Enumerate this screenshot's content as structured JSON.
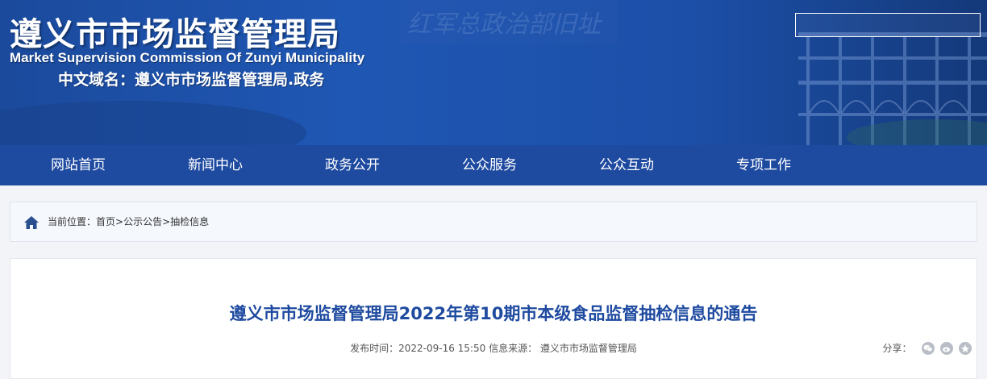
{
  "header": {
    "title": "遵义市市场监督管理局",
    "subtitle": "Market Supervision Commission Of Zunyi Municipality",
    "domain": "中文域名：遵义市市场监督管理局.政务",
    "background_calligraphy": "红军总政治部旧址"
  },
  "search": {
    "placeholder": ""
  },
  "nav": {
    "items": [
      {
        "label": "网站首页"
      },
      {
        "label": "新闻中心"
      },
      {
        "label": "政务公开"
      },
      {
        "label": "公众服务"
      },
      {
        "label": "公众互动"
      },
      {
        "label": "专项工作"
      }
    ]
  },
  "breadcrumb": {
    "prefix": "当前位置：",
    "items": [
      {
        "label": "首页"
      },
      {
        "label": "公示公告"
      },
      {
        "label": "抽检信息"
      }
    ],
    "separator": ">"
  },
  "article": {
    "title": "遵义市市场监督管理局2022年第10期市本级食品监督抽检信息的通告",
    "publish_label": "发布时间：",
    "publish_time": "2022-09-16 15:50",
    "source_label": "信息来源：",
    "source": "遵义市市场监督管理局"
  },
  "share": {
    "label": "分享：",
    "icons": [
      "wechat-icon",
      "weibo-icon",
      "qzone-icon"
    ]
  },
  "colors": {
    "brand_blue": "#1e4aa0",
    "title_blue": "#1e4aa0",
    "banner_blue": "#1f57b4"
  }
}
